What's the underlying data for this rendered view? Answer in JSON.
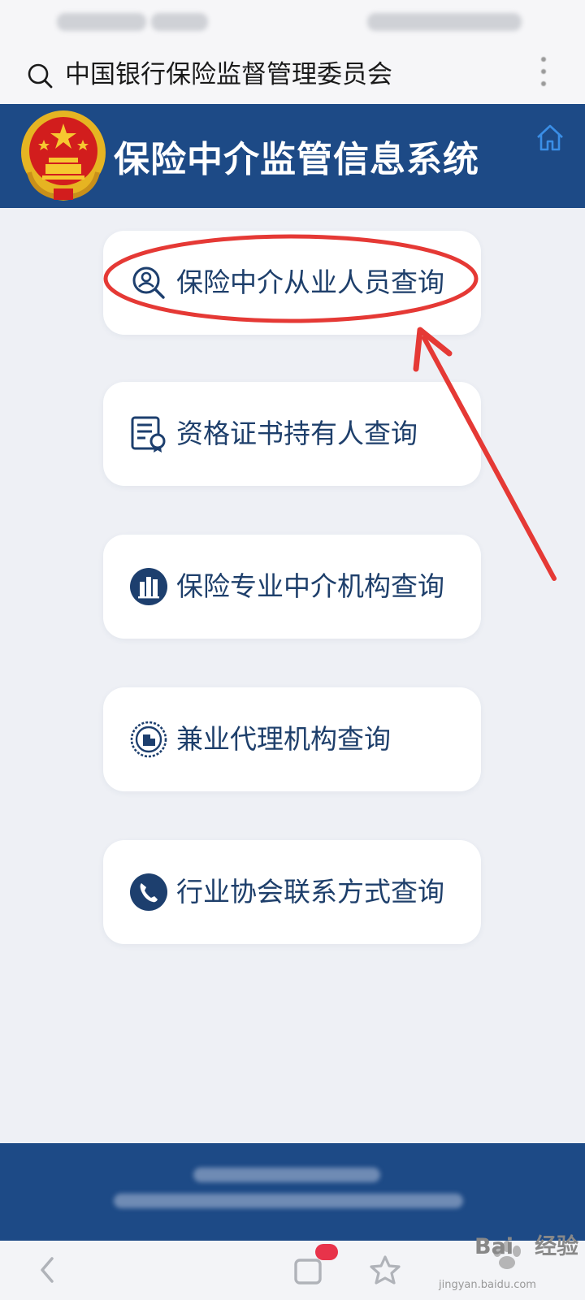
{
  "browser": {
    "search_query": "中国银行保险监督管理委员会"
  },
  "banner": {
    "title": "保险中介监管信息系统"
  },
  "menu": {
    "items": [
      {
        "label": "保险中介从业人员查询",
        "icon": "person-search-icon"
      },
      {
        "label": "资格证书持有人查询",
        "icon": "certificate-icon"
      },
      {
        "label": "保险专业中介机构查询",
        "icon": "building-icon"
      },
      {
        "label": "兼业代理机构查询",
        "icon": "agency-seal-icon"
      },
      {
        "label": "行业协会联系方式查询",
        "icon": "phone-icon"
      }
    ]
  },
  "watermark": {
    "brand": "Bai",
    "brand_suffix": "经验",
    "url": "jingyan.baidu.com"
  },
  "colors": {
    "brand_blue": "#1d4a86",
    "label_blue": "#1e3f6b",
    "annotation_red": "#e53935",
    "page_bg": "#eef0f5"
  }
}
